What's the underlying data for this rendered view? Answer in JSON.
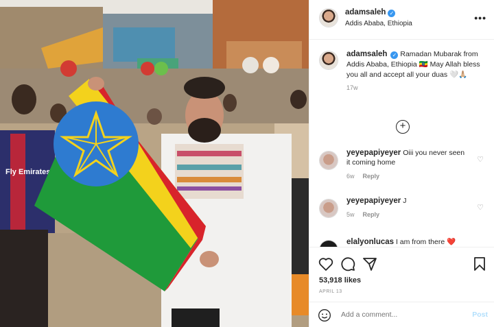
{
  "post": {
    "username": "adamsaleh",
    "location": "Addis Ababa, Ethiopia",
    "more_icon": "more-icon",
    "verified_icon": "verified-badge-icon"
  },
  "caption": {
    "username": "adamsaleh",
    "text": "Ramadan Mubarak from Addis Ababa, Ethiopia 🇪🇹 May Allah bless you all and accept all your duas 🤍🙏🏼",
    "time": "17w"
  },
  "load_more_icon": "plus-circle-icon",
  "comments": [
    {
      "username": "yeyepapiyeyer",
      "text": "Oiii you never seen it coming home",
      "time": "6w",
      "reply": "Reply"
    },
    {
      "username": "yeyepapiyeyer",
      "text": "J",
      "time": "5w",
      "reply": "Reply"
    },
    {
      "username": "elalyonlucas",
      "text": "I am from there ❤️"
    }
  ],
  "actions": {
    "like_icon": "heart-icon",
    "comment_icon": "comment-icon",
    "share_icon": "send-icon",
    "save_icon": "bookmark-icon",
    "likes": "53,918 likes",
    "date": "APRIL 13"
  },
  "add_comment": {
    "placeholder": "Add a comment...",
    "post_label": "Post",
    "emoji_icon": "smiley-icon"
  },
  "photo": {
    "shirt_text": "Fly Emirates",
    "description_icon": "photo"
  },
  "colors": {
    "link_blue": "#3897f0",
    "post_disabled": "#b2dffc",
    "muted": "#8e8e8e",
    "flag_green": "#1f9a3a",
    "flag_yellow": "#f3d21c",
    "flag_red": "#d8242b",
    "flag_blue": "#2e7bd0"
  }
}
